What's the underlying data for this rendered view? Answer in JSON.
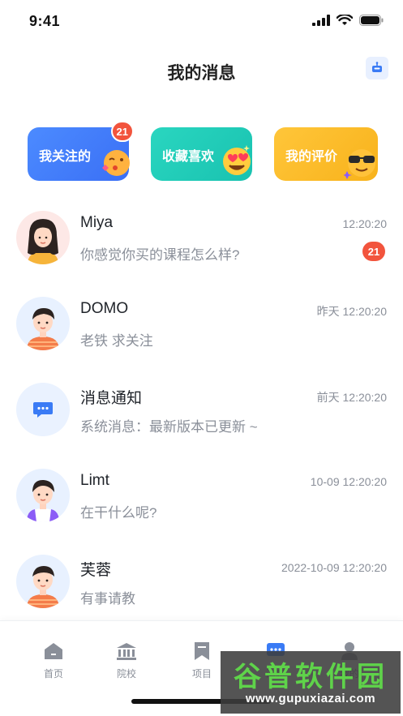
{
  "status_bar": {
    "time": "9:41"
  },
  "header": {
    "title": "我的消息"
  },
  "cards": [
    {
      "label": "我关注的",
      "badge": "21",
      "color": "#4c8bff"
    },
    {
      "label": "收藏喜欢",
      "color": "#2ad6c0"
    },
    {
      "label": "我的评价",
      "color": "#ffc63a"
    }
  ],
  "messages": [
    {
      "name": "Miya",
      "time": "12:20:20",
      "preview": "你感觉你买的课程怎么样?",
      "badge": "21"
    },
    {
      "name": "DOMO",
      "time": "昨天 12:20:20",
      "preview": "老铁 求关注"
    },
    {
      "name": "消息通知",
      "time": "前天 12:20:20",
      "preview": "系统消息：最新版本已更新 ~"
    },
    {
      "name": "Limt",
      "time": "10-09 12:20:20",
      "preview": "在干什么呢?"
    },
    {
      "name": "芙蓉",
      "time": "2022-10-09 12:20:20",
      "preview": "有事请教"
    }
  ],
  "tabs": [
    {
      "label": "首页",
      "icon": "home-icon"
    },
    {
      "label": "院校",
      "icon": "school-icon"
    },
    {
      "label": "项目",
      "icon": "bookmark-icon"
    },
    {
      "label": "消息",
      "icon": "message-icon"
    },
    {
      "label": "我的",
      "icon": "user-icon"
    }
  ],
  "watermark": {
    "main": "谷普软件园",
    "sub": "www.gupuxiazai.com"
  },
  "colors": {
    "accent": "#3a7bf5",
    "badge": "#f2543d",
    "text_secondary": "#8a8f99"
  }
}
